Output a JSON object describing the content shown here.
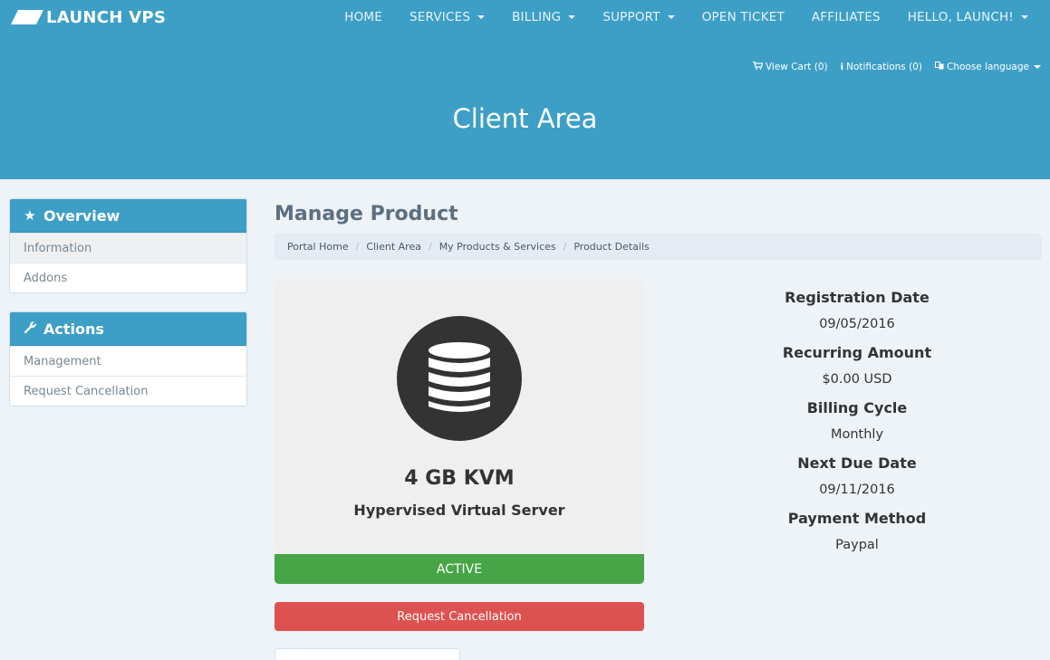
{
  "brand": {
    "name": "LAUNCH VPS",
    "icon": "launch-logo-icon"
  },
  "nav": [
    {
      "label": "HOME",
      "dropdown": false
    },
    {
      "label": "SERVICES",
      "dropdown": true
    },
    {
      "label": "BILLING",
      "dropdown": true
    },
    {
      "label": "SUPPORT",
      "dropdown": true
    },
    {
      "label": "OPEN TICKET",
      "dropdown": false
    },
    {
      "label": "AFFILIATES",
      "dropdown": false
    },
    {
      "label": "HELLO, LAUNCH!",
      "dropdown": true
    }
  ],
  "utility": {
    "cart": "View Cart (0)",
    "notifications": "Notifications (0)",
    "language": "Choose language"
  },
  "page_heading": "Client Area",
  "sidebar": {
    "overview": {
      "title": "Overview",
      "icon": "star-icon",
      "items": [
        "Information",
        "Addons"
      ]
    },
    "actions": {
      "title": "Actions",
      "icon": "wrench-icon",
      "items": [
        "Management",
        "Request Cancellation"
      ]
    }
  },
  "main": {
    "title": "Manage Product",
    "breadcrumb": [
      "Portal Home",
      "Client Area",
      "My Products & Services",
      "Product Details"
    ],
    "product": {
      "icon": "database-icon",
      "name": "4 GB KVM",
      "group": "Hypervised Virtual Server",
      "status": "ACTIVE"
    },
    "cancel_button": "Request Cancellation",
    "details": [
      {
        "label": "Registration Date",
        "value": "09/05/2016"
      },
      {
        "label": "Recurring Amount",
        "value": "$0.00 USD"
      },
      {
        "label": "Billing Cycle",
        "value": "Monthly"
      },
      {
        "label": "Next Due Date",
        "value": "09/11/2016"
      },
      {
        "label": "Payment Method",
        "value": "Paypal"
      }
    ]
  },
  "colors": {
    "header": "#3d9fc6",
    "status_active": "#47a547",
    "danger": "#dd5250",
    "page_bg": "#eef3f8"
  }
}
